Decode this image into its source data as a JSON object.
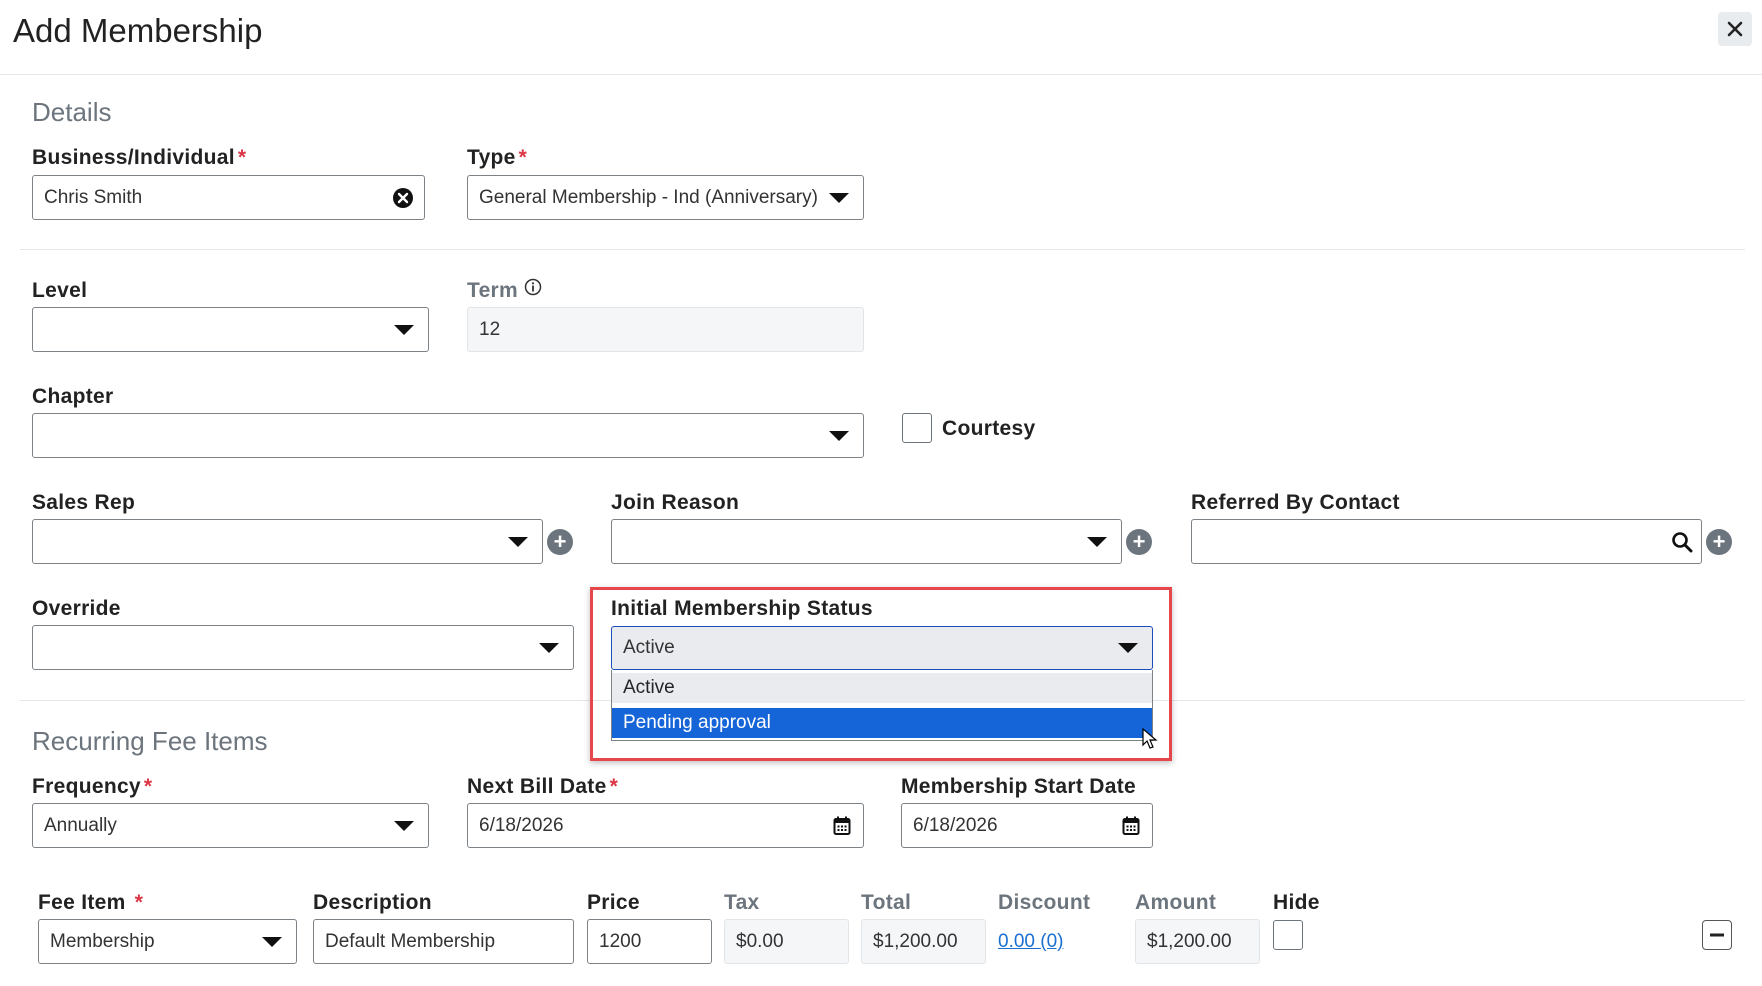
{
  "dialog": {
    "title": "Add Membership"
  },
  "details": {
    "section_title": "Details",
    "business": {
      "label": "Business/Individual",
      "required": "*",
      "value": "Chris Smith"
    },
    "type": {
      "label": "Type",
      "required": "*",
      "value": "General Membership - Ind (Anniversary)"
    },
    "level": {
      "label": "Level",
      "value": ""
    },
    "term": {
      "label": "Term",
      "value": "12"
    },
    "chapter": {
      "label": "Chapter",
      "value": ""
    },
    "courtesy": {
      "label": "Courtesy",
      "checked": false
    },
    "sales_rep": {
      "label": "Sales Rep",
      "value": ""
    },
    "join_reason": {
      "label": "Join Reason",
      "value": ""
    },
    "referred_by": {
      "label": "Referred By Contact",
      "value": ""
    },
    "override": {
      "label": "Override",
      "value": ""
    },
    "initial_status": {
      "label": "Initial Membership Status",
      "value": "Active",
      "options": [
        "Active",
        "Pending approval"
      ],
      "highlighted_option": "Pending approval"
    }
  },
  "recurring": {
    "section_title": "Recurring Fee Items",
    "frequency": {
      "label": "Frequency",
      "required": "*",
      "value": "Annually"
    },
    "next_bill_date": {
      "label": "Next Bill Date",
      "required": "*",
      "value": "6/18/2026"
    },
    "start_date": {
      "label": "Membership Start Date",
      "value": "6/18/2026"
    },
    "fee_table": {
      "headers": {
        "fee_item": "Fee Item",
        "fee_item_required": "*",
        "description": "Description",
        "price": "Price",
        "tax": "Tax",
        "total": "Total",
        "discount": "Discount",
        "amount": "Amount",
        "hide": "Hide"
      },
      "row": {
        "fee_item": "Membership",
        "description": "Default Membership",
        "price": "1200",
        "tax": "$0.00",
        "total": "$1,200.00",
        "discount": "0.00 (0)",
        "amount": "$1,200.00",
        "hide": false
      }
    }
  },
  "colors": {
    "highlight_border": "#e5474b",
    "selected_option": "#1565d8",
    "required": "#dc3545",
    "link": "#1a6fd0"
  },
  "icons": [
    "close-icon",
    "clear-icon",
    "chevron-down-icon",
    "info-icon",
    "plus-icon",
    "search-icon",
    "calendar-icon",
    "minus-icon",
    "mouse-cursor-icon"
  ]
}
